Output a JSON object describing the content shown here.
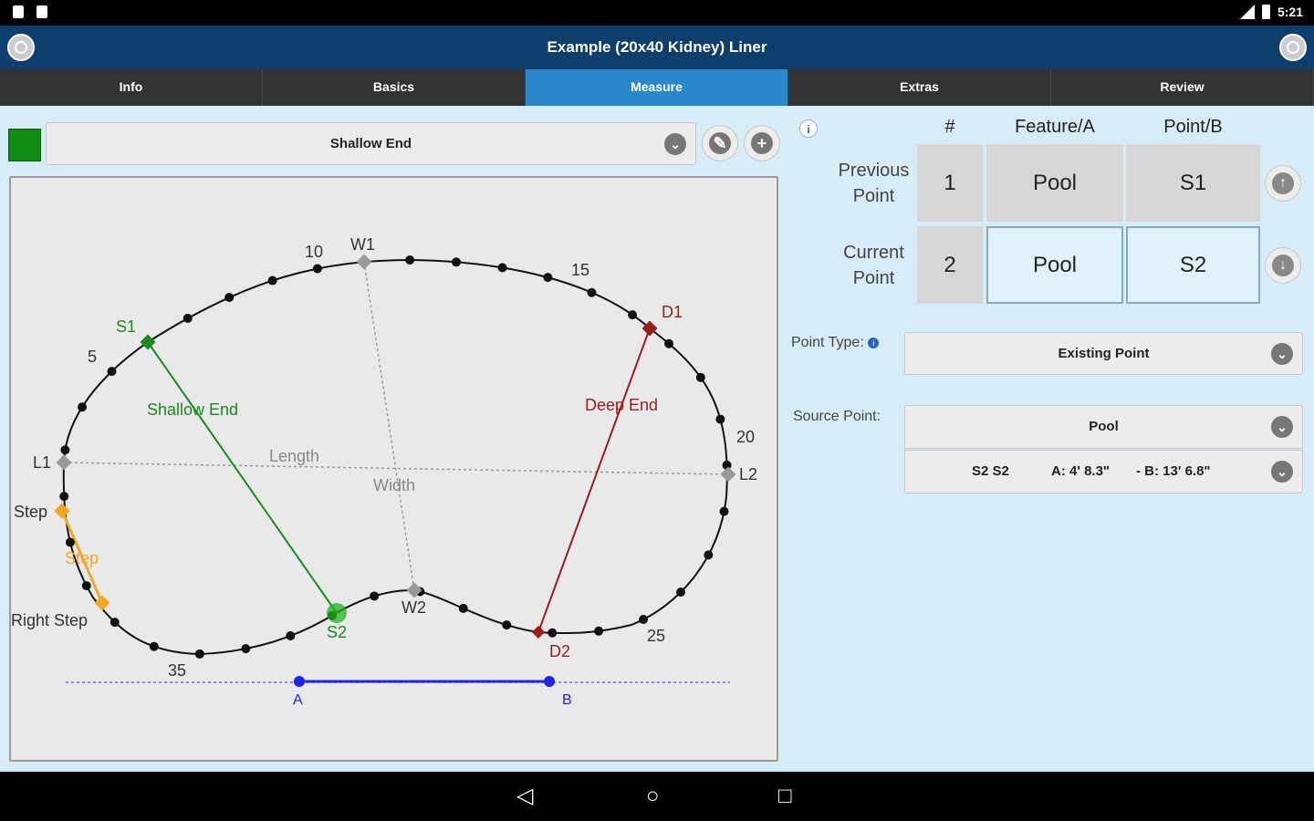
{
  "window": {
    "title": "Example (20x40 Kidney) Liner",
    "time": "5:21"
  },
  "tabs": [
    {
      "label": "Info"
    },
    {
      "label": "Basics"
    },
    {
      "label": "Measure",
      "active": true
    },
    {
      "label": "Extras"
    },
    {
      "label": "Review"
    }
  ],
  "measurement_select": {
    "value": "Shallow End",
    "color": "#128b12"
  },
  "grid": {
    "headers": {
      "num": "#",
      "feature": "Feature/A",
      "point": "Point/B"
    },
    "rows": [
      {
        "label_line1": "Previous",
        "label_line2": "Point",
        "num": "1",
        "feature": "Pool",
        "point": "S1"
      },
      {
        "label_line1": "Current",
        "label_line2": "Point",
        "num": "2",
        "feature": "Pool",
        "point": "S2"
      }
    ]
  },
  "point_type": {
    "label": "Point Type:",
    "value": "Existing Point"
  },
  "source_point": {
    "label": "Source Point:",
    "value": "Pool",
    "detail_name": "S2 S2",
    "detail_a": "A: 4' 8.3\"",
    "detail_b": "- B: 13' 6.8\""
  },
  "diagram": {
    "labels": {
      "w1": "W1",
      "w2": "W2",
      "l1": "L1",
      "l2": "L2",
      "s1": "S1",
      "s2": "S2",
      "d1": "D1",
      "d2": "D2",
      "n5": "5",
      "n10": "10",
      "n15": "15",
      "n20": "20",
      "n25": "25",
      "n35": "35",
      "shallow_end": "Shallow End",
      "deep_end": "Deep End",
      "length": "Length",
      "width": "Width",
      "step_point": "Step",
      "step_line": "Step",
      "right_step": "Right Step",
      "a": "A",
      "b": "B"
    },
    "colors": {
      "shallow": "#1a8a1a",
      "deep": "#9a1c1c",
      "step": "#f5a623",
      "baseline": "#2222ee",
      "guide": "#999999",
      "dot": "#111111"
    }
  },
  "icons": {
    "menu": "menu-circle-icon",
    "info": "info-circle-icon",
    "edit": "pencil-icon",
    "add": "plus-icon",
    "up": "arrow-up-icon",
    "down": "arrow-down-icon",
    "back": "nav-back-icon",
    "home": "nav-home-icon",
    "recents": "nav-recents-icon"
  }
}
